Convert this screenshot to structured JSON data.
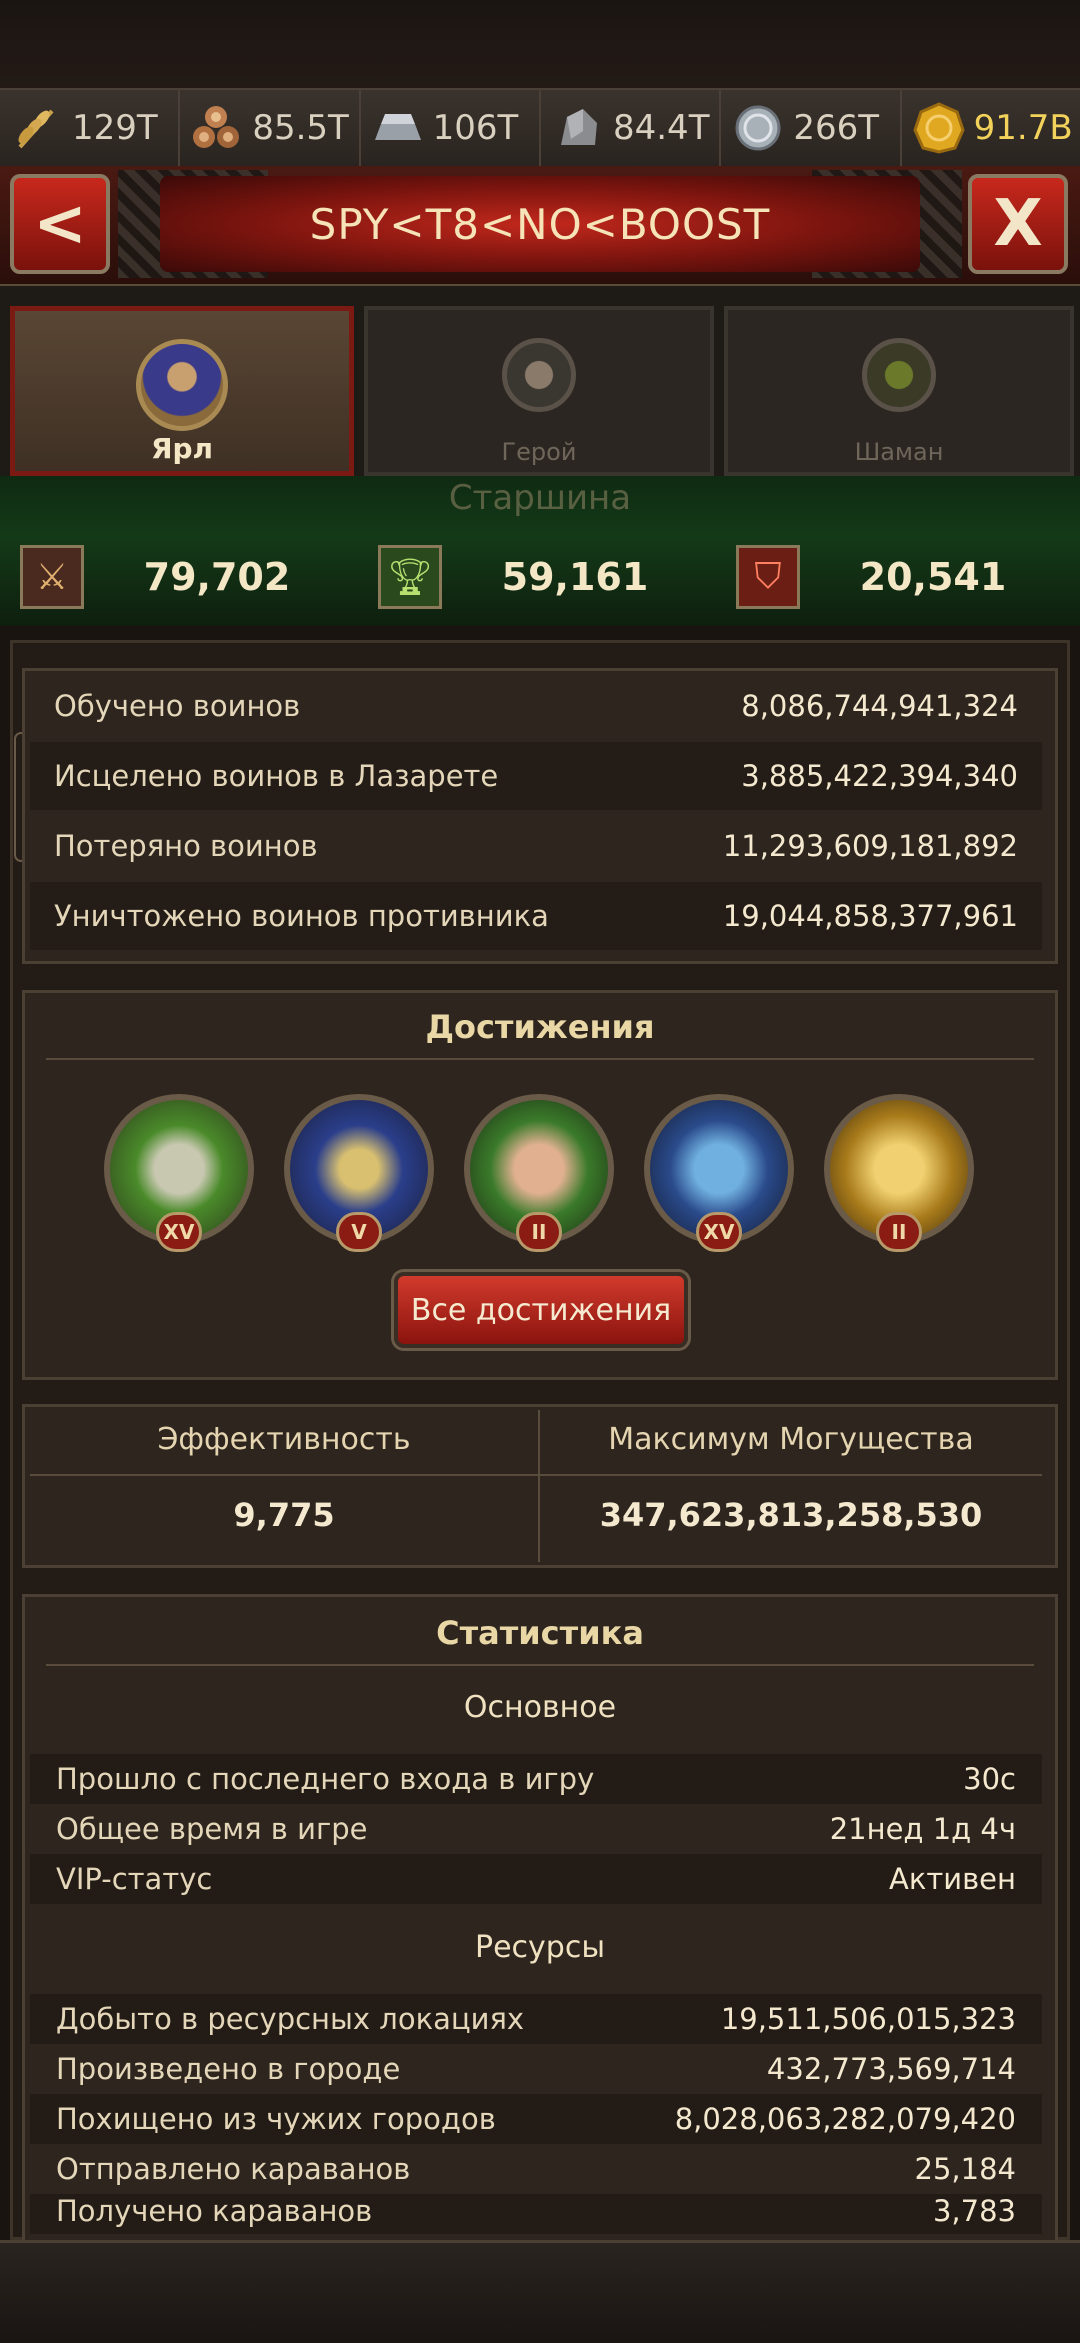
{
  "resources": [
    {
      "icon": "wheat-icon",
      "value": "129T"
    },
    {
      "icon": "wood-logs-icon",
      "value": "85.5T"
    },
    {
      "icon": "iron-ingot-icon",
      "value": "106T"
    },
    {
      "icon": "stone-icon",
      "value": "84.4T"
    },
    {
      "icon": "silver-coin-icon",
      "value": "266T"
    },
    {
      "icon": "gold-coin-icon",
      "value": "91.7B"
    }
  ],
  "header": {
    "title": "SPY<T8<NO<BOOST",
    "back_label": "<",
    "close_label": "X"
  },
  "tabs": [
    {
      "label": "Ярл",
      "active": true
    },
    {
      "label": "Герой",
      "active": false
    },
    {
      "label": "Шаман",
      "active": false
    }
  ],
  "faded_label": "Старшина",
  "scores": [
    {
      "icon": "crossed-swords-icon",
      "value": "79,702"
    },
    {
      "icon": "trophy-icon",
      "value": "59,161"
    },
    {
      "icon": "broken-shield-icon",
      "value": "20,541"
    }
  ],
  "combat_stats": [
    {
      "label": "Обучено воинов",
      "value": "8,086,744,941,324"
    },
    {
      "label": "Исцелено воинов в Лазарете",
      "value": "3,885,422,394,340"
    },
    {
      "label": "Потеряно воинов",
      "value": "11,293,609,181,892"
    },
    {
      "label": "Уничтожено воинов противника",
      "value": "19,044,858,377,961"
    }
  ],
  "achievements": {
    "title": "Достижения",
    "badges": [
      {
        "icon": "stone-mask-icon",
        "rank": "XV",
        "color": "#4a8a2a"
      },
      {
        "icon": "rings-icon",
        "rank": "V",
        "color": "#2a3e8a"
      },
      {
        "icon": "hand-chalice-icon",
        "rank": "II",
        "color": "#3a7a2a"
      },
      {
        "icon": "comet-icon",
        "rank": "XV",
        "color": "#2a4a8a"
      },
      {
        "icon": "golden-fist-icon",
        "rank": "II",
        "color": "#a87a1a"
      }
    ],
    "all_button": "Все достижения"
  },
  "efficiency": {
    "left_label": "Эффективность",
    "left_value": "9,775",
    "right_label": "Максимум Могущества",
    "right_value": "347,623,813,258,530"
  },
  "statistics": {
    "title": "Статистика",
    "main_heading": "Основное",
    "main_rows": [
      {
        "label": "Прошло с последнего входа в игру",
        "value": "30с"
      },
      {
        "label": "Общее время в игре",
        "value": "21нед 1д 4ч"
      },
      {
        "label": "VIP-статус",
        "value": "Активен"
      }
    ],
    "resources_heading": "Ресурсы",
    "resource_rows": [
      {
        "label": "Добыто в ресурсных локациях",
        "value": "19,511,506,015,323"
      },
      {
        "label": "Произведено в городе",
        "value": "432,773,569,714"
      },
      {
        "label": "Похищено из чужих городов",
        "value": "8,028,063,282,079,420"
      },
      {
        "label": "Отправлено караванов",
        "value": "25,184"
      },
      {
        "label": "Получено караванов",
        "value": "3,783"
      }
    ]
  }
}
